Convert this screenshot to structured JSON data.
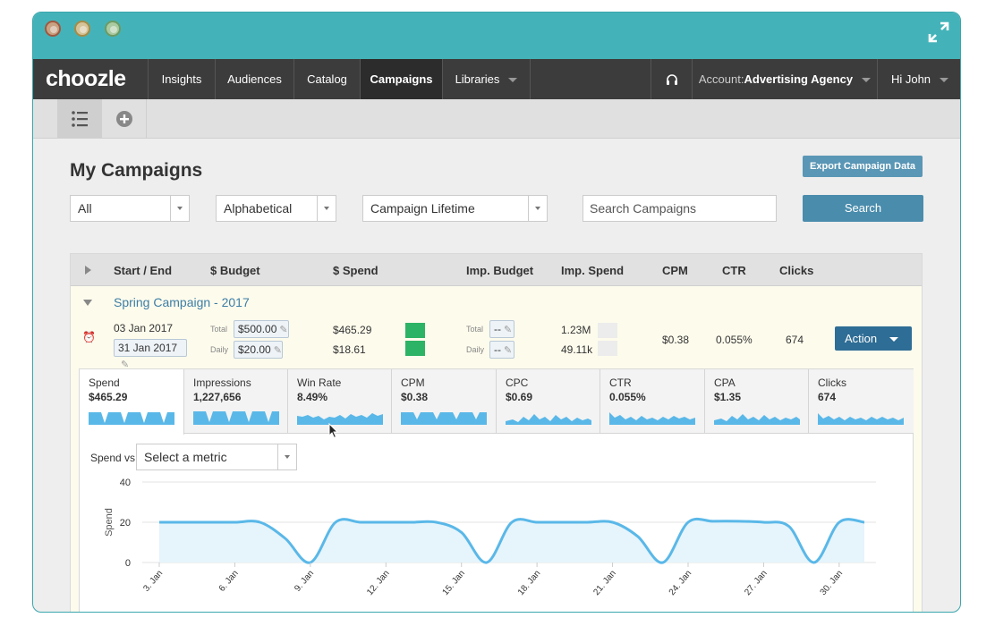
{
  "nav": {
    "logo": "choozle",
    "items": [
      {
        "label": "Insights"
      },
      {
        "label": "Audiences"
      },
      {
        "label": "Catalog"
      },
      {
        "label": "Campaigns"
      },
      {
        "label": "Libraries"
      }
    ],
    "account_prefix": "Account:",
    "account_name": "Advertising Agency",
    "user_greeting": "Hi John"
  },
  "page": {
    "title": "My Campaigns",
    "export_label": "Export Campaign Data"
  },
  "filters": {
    "status": "All",
    "sort": "Alphabetical",
    "range": "Campaign Lifetime",
    "search_placeholder": "Search Campaigns",
    "search_label": "Search"
  },
  "table": {
    "headers": [
      "Start / End",
      "$ Budget",
      "$ Spend",
      "Imp. Budget",
      "Imp. Spend",
      "CPM",
      "CTR",
      "Clicks"
    ],
    "campaign": {
      "name": "Spring Campaign - 2017",
      "start": "03 Jan 2017",
      "end": "31 Jan 2017",
      "budget_total_label": "Total",
      "budget_total": "$500.00",
      "budget_daily_label": "Daily",
      "budget_daily": "$20.00",
      "spend_total": "$465.29",
      "spend_daily": "$18.61",
      "imp_budget_total_label": "Total",
      "imp_budget_total": "--",
      "imp_budget_daily_label": "Daily",
      "imp_budget_daily": "--",
      "imp_spend_total": "1.23M",
      "imp_spend_daily": "49.11k",
      "cpm": "$0.38",
      "ctr": "0.055%",
      "clicks": "674",
      "action_label": "Action"
    }
  },
  "metric_tabs": [
    {
      "label": "Spend",
      "value": "$465.29",
      "active": true
    },
    {
      "label": "Impressions",
      "value": "1,227,656"
    },
    {
      "label": "Win Rate",
      "value": "8.49%"
    },
    {
      "label": "CPM",
      "value": "$0.38"
    },
    {
      "label": "CPC",
      "value": "$0.69"
    },
    {
      "label": "CTR",
      "value": "0.055%"
    },
    {
      "label": "CPA",
      "value": "$1.35"
    },
    {
      "label": "Clicks",
      "value": "674"
    }
  ],
  "compare": {
    "label": "Spend vs.",
    "select_value": "Select a metric"
  },
  "colors": {
    "accent": "#44b3b9",
    "nav_bg": "#3c3c3c",
    "button_blue": "#4a8cac",
    "action_blue": "#2e6d95",
    "link_blue": "#3d7ea6",
    "status_green": "#2db365",
    "series": "#5ab8e8",
    "series_fill": "#e6f4fb"
  },
  "icons": {
    "list_view": "list-icon",
    "add": "plus-circle-icon",
    "support": "headset-icon",
    "expand": "expand-icon",
    "alarm": "alarm-clock-icon",
    "edit": "pencil-icon",
    "cursor": "mouse-cursor-icon"
  },
  "chart_data": {
    "type": "area",
    "title": "",
    "ylabel": "Spend",
    "ylim": [
      0,
      40
    ],
    "yticks": [
      0,
      20,
      40
    ],
    "xticks": [
      "3. Jan",
      "6. Jan",
      "9. Jan",
      "12. Jan",
      "15. Jan",
      "18. Jan",
      "21. Jan",
      "24. Jan",
      "27. Jan",
      "30. Jan"
    ],
    "x": [
      3,
      4,
      5,
      6,
      7,
      8,
      9,
      10,
      11,
      12,
      13,
      14,
      15,
      16,
      17,
      18,
      19,
      20,
      21,
      22,
      23,
      24,
      25,
      26,
      27,
      28,
      29,
      30,
      31
    ],
    "series": [
      {
        "values": [
          20,
          20,
          20,
          20,
          20,
          12,
          0,
          20,
          20,
          20,
          20,
          20,
          15,
          0,
          20,
          20,
          20,
          20,
          20,
          13,
          0,
          20,
          20.5,
          20.5,
          20,
          18,
          0,
          20,
          20
        ]
      }
    ],
    "grid": true
  }
}
